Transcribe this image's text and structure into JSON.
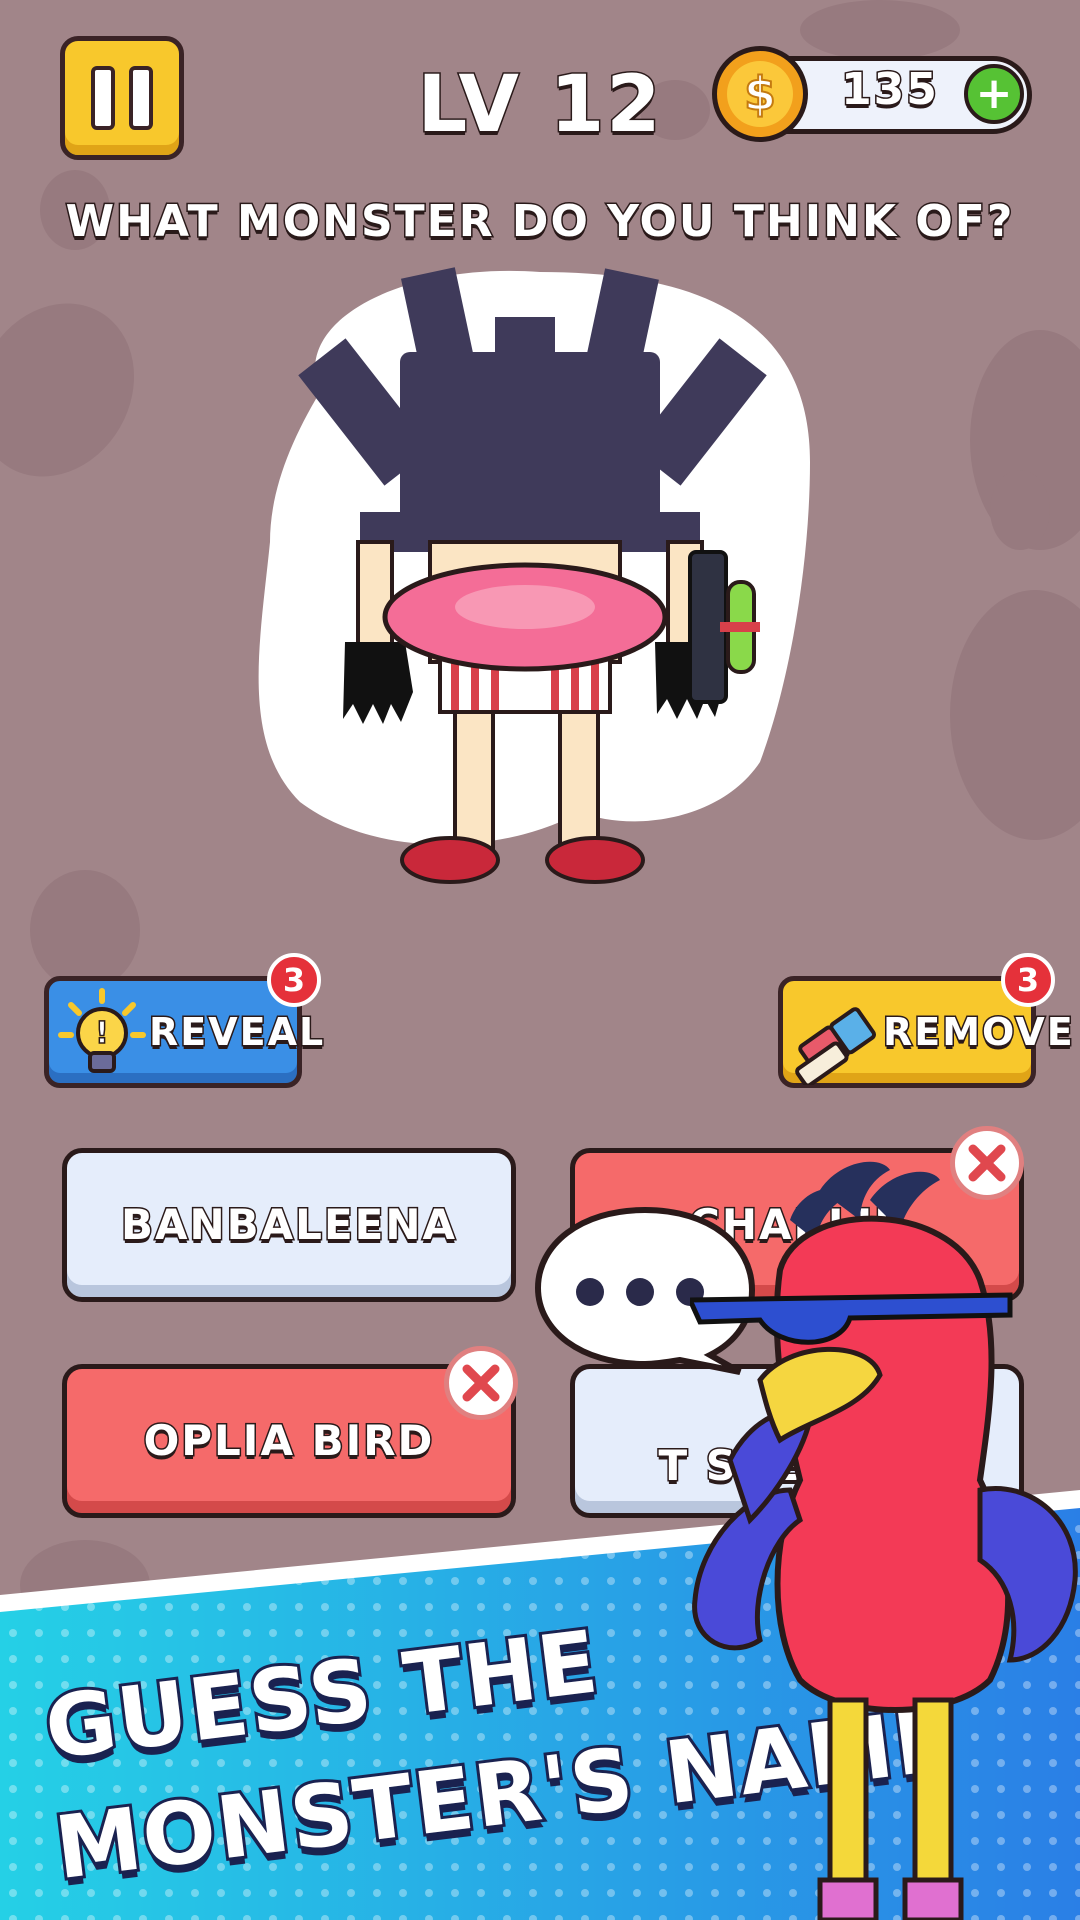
{
  "header": {
    "level_label": "LV 12",
    "coins": "135",
    "add_label": "+"
  },
  "question": "WHAT MONSTER DO YOU THINK OF?",
  "hints": {
    "reveal": {
      "label": "REVEAL",
      "count": "3"
    },
    "remove": {
      "label": "REMOVE",
      "count": "3"
    }
  },
  "answers": [
    {
      "label": "BANBALEENA",
      "state": "normal"
    },
    {
      "label": "CHARLIE",
      "state": "wrong"
    },
    {
      "label": "OPLIA BIRD",
      "state": "wrong"
    },
    {
      "label": "T SPEAKER",
      "state": "normal"
    }
  ],
  "banner": {
    "line1": "GUESS THE",
    "line2": "MONSTER'S NAME"
  },
  "colors": {
    "background": "#a18589",
    "pause": "#f8c82c",
    "reveal": "#3a8fe6",
    "remove": "#f8c82c",
    "wrong_answer": "#f56a6a",
    "normal_answer": "#e5edfb",
    "banner": "#1fb8e6"
  },
  "icons": {
    "pause": "pause-icon",
    "coin": "coin-icon",
    "add": "plus-icon",
    "reveal": "lightbulb-icon",
    "remove": "eraser-icon",
    "wrong": "x-icon"
  }
}
